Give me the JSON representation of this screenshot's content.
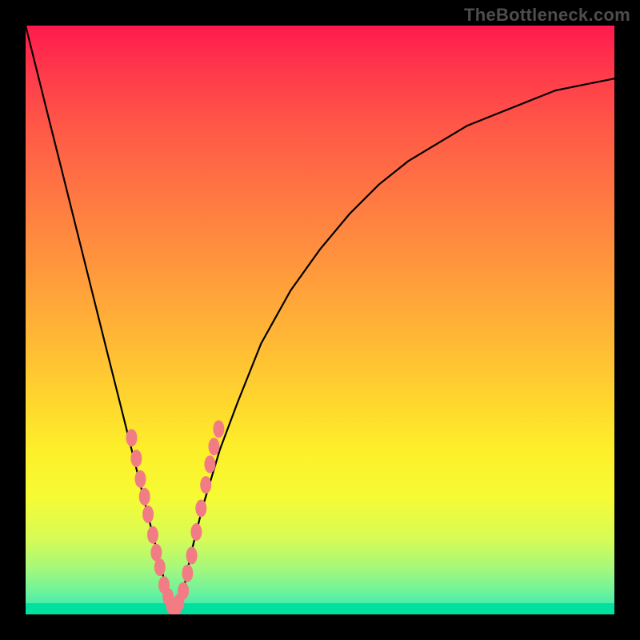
{
  "watermark": "TheBottleneck.com",
  "colors": {
    "frame": "#000000",
    "curve_stroke": "#000000",
    "dot_fill": "#f27c84",
    "dot_stroke": "#c95a62",
    "green_stripe": "#00e09e"
  },
  "chart_data": {
    "type": "line",
    "title": "",
    "xlabel": "",
    "ylabel": "",
    "xlim": [
      0,
      100
    ],
    "ylim": [
      0,
      100
    ],
    "grid": false,
    "legend": false,
    "notes": "V-shaped bottleneck curve. Minimum near x≈25, y≈0. Salmon dots cluster near the trough on both branches.",
    "series": [
      {
        "name": "bottleneck_curve",
        "x": [
          0,
          2,
          4,
          6,
          8,
          10,
          12,
          14,
          16,
          18,
          20,
          22,
          23,
          24,
          25,
          26,
          27,
          28,
          30,
          33,
          36,
          40,
          45,
          50,
          55,
          60,
          65,
          70,
          75,
          80,
          85,
          90,
          95,
          100
        ],
        "y": [
          100,
          92,
          84,
          76,
          68,
          60,
          52,
          44,
          36,
          28,
          20,
          12,
          8,
          4,
          1,
          2,
          5,
          10,
          18,
          28,
          36,
          46,
          55,
          62,
          68,
          73,
          77,
          80,
          83,
          85,
          87,
          89,
          90,
          91
        ]
      }
    ],
    "dots": {
      "name": "sample_points",
      "x": [
        18.0,
        18.8,
        19.5,
        20.2,
        20.8,
        21.6,
        22.2,
        22.8,
        23.5,
        24.2,
        24.8,
        25.5,
        26.0,
        26.8,
        27.5,
        28.2,
        29.0,
        29.8,
        30.6,
        31.3,
        32.0,
        32.8
      ],
      "y": [
        30.0,
        26.5,
        23.0,
        20.0,
        17.0,
        13.5,
        10.5,
        8.0,
        5.0,
        3.0,
        1.5,
        1.0,
        2.0,
        4.0,
        7.0,
        10.0,
        14.0,
        18.0,
        22.0,
        25.5,
        28.5,
        31.5
      ]
    }
  }
}
